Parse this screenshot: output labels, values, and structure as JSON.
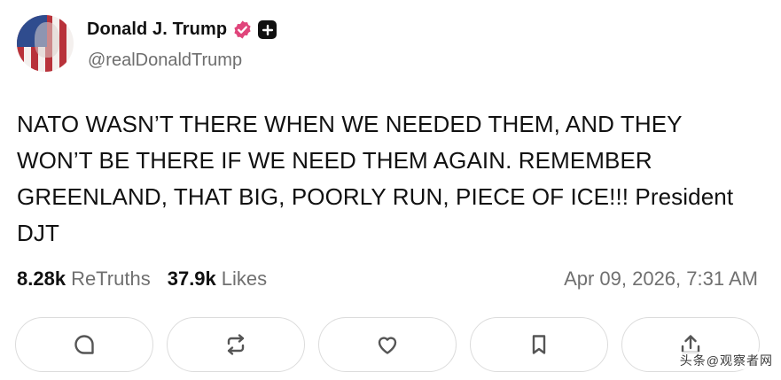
{
  "author": {
    "display_name": "Donald J. Trump",
    "handle": "@realDonaldTrump",
    "avatar_icon": "flag-portrait-avatar",
    "verified_icon": "verified-badge-icon",
    "verified_color": "#e0457b",
    "plus_icon": "plus-badge-icon"
  },
  "post": {
    "text": "NATO WASN’T THERE WHEN WE NEEDED THEM, AND THEY WON’T BE THERE IF WE NEED THEM AGAIN. REMEMBER GREENLAND, THAT BIG, POORLY RUN, PIECE OF ICE!!! President DJT"
  },
  "stats": {
    "retruths_count": "8.28k",
    "retruths_label": "ReTruths",
    "likes_count": "37.9k",
    "likes_label": "Likes",
    "timestamp": "Apr 09, 2026, 7:31 AM"
  },
  "actions": [
    {
      "icon": "reply-icon"
    },
    {
      "icon": "retruth-icon"
    },
    {
      "icon": "like-icon"
    },
    {
      "icon": "bookmark-icon"
    },
    {
      "icon": "share-icon"
    }
  ],
  "watermark": "头条@观察者网"
}
